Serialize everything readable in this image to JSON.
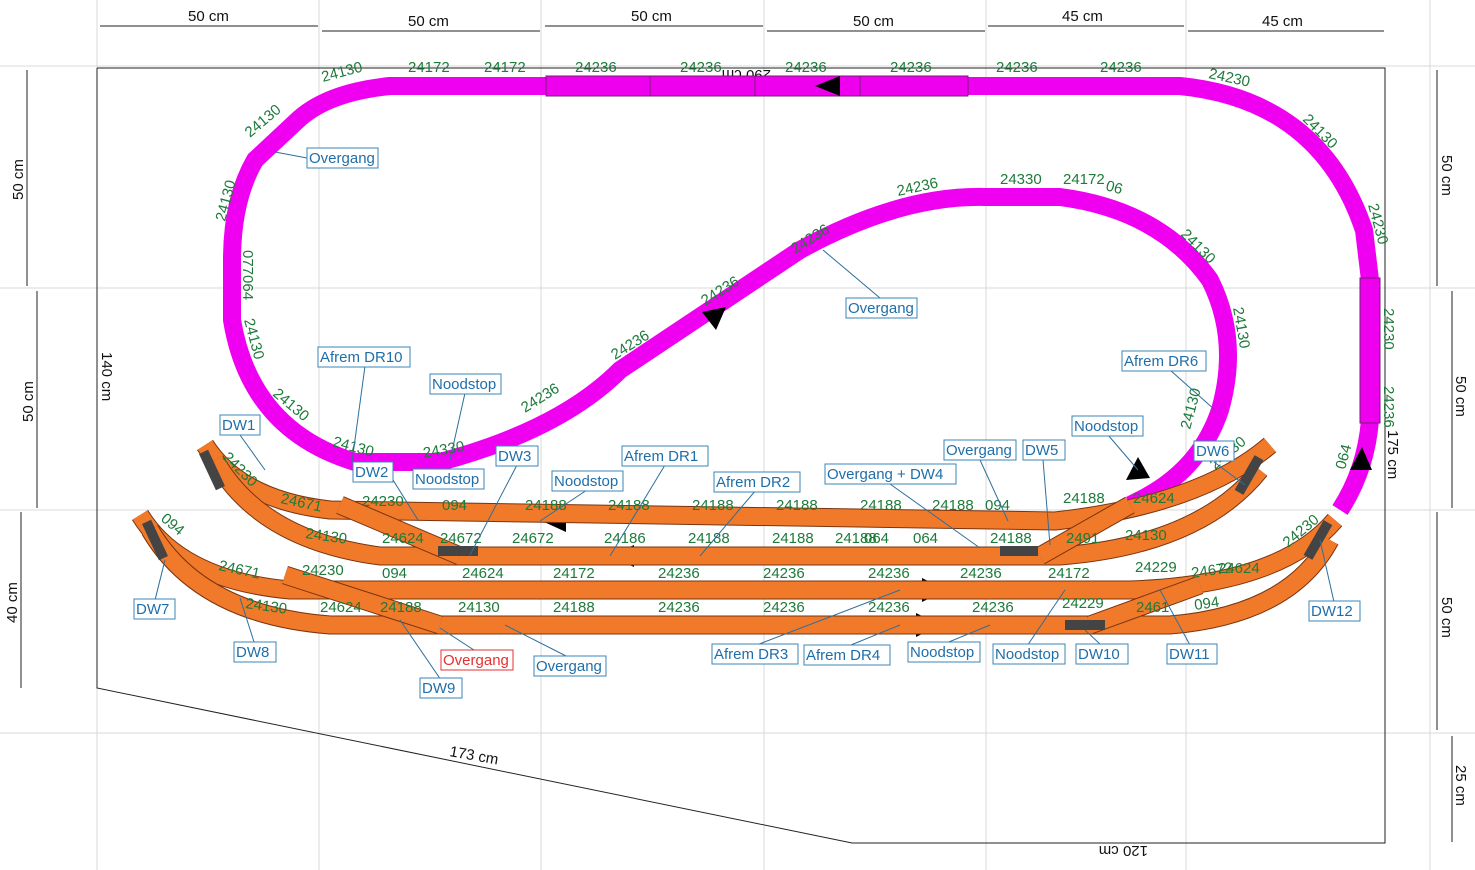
{
  "colors": {
    "upper_track": "#f000f0",
    "lower_track": "#f07a2a",
    "track_code": "#1d7a3a",
    "label_text": "#1f6ea9",
    "label_alert": "#e53030"
  },
  "dimensions": {
    "top": [
      "50 cm",
      "50 cm",
      "50 cm",
      "50 cm",
      "45 cm",
      "45 cm"
    ],
    "left": [
      "50 cm",
      "50 cm",
      "40 cm"
    ],
    "right": [
      "50 cm",
      "50 cm",
      "50 cm",
      "25 cm"
    ],
    "board_left": "140 cm",
    "board_right": "175 cm",
    "board_top_inner": "290 cm",
    "board_diagonal": "173 cm",
    "board_bottom": "120 cm"
  },
  "track_codes": [
    "24130",
    "24172",
    "24172",
    "24236",
    "24236",
    "24236",
    "24236",
    "24236",
    "24236",
    "24230",
    "24130",
    "24130",
    "077064",
    "24130",
    "24130",
    "24130",
    "24330",
    "24236",
    "24236",
    "24236",
    "24236",
    "24236",
    "24330",
    "24172",
    "06",
    "24130",
    "24130",
    "24130",
    "24130",
    "24230",
    "24230",
    "24236",
    "064",
    "24230",
    "24671",
    "24130",
    "24230",
    "24624",
    "094",
    "24188",
    "24188",
    "24188",
    "24188",
    "24188",
    "24188",
    "094",
    "24188",
    "24624",
    "24130",
    "24230",
    "24672",
    "24672",
    "24186",
    "24188",
    "24188",
    "24188",
    "064",
    "064",
    "24188",
    "2491",
    "094",
    "24671",
    "24130",
    "24230",
    "24624",
    "094",
    "24188",
    "24624",
    "24172",
    "24236",
    "24236",
    "24236",
    "24236",
    "24172",
    "24229",
    "24624",
    "24130",
    "24188",
    "24236",
    "24236",
    "24236",
    "24236",
    "24229",
    "2461",
    "094",
    "24230",
    "24672",
    "24130"
  ],
  "labels": {
    "overgang_1": "Overgang",
    "overgang_2": "Overgang",
    "afrem_dr10": "Afrem DR10",
    "noodstop_1": "Noodstop",
    "afrem_dr6": "Afrem DR6",
    "noodstop_2": "Noodstop",
    "dw1": "DW1",
    "dw2": "DW2",
    "noodstop_3": "Noodstop",
    "dw3": "DW3",
    "noodstop_4": "Noodstop",
    "afrem_dr1": "Afrem DR1",
    "afrem_dr2": "Afrem DR2",
    "overgang_3": "Overgang",
    "dw5": "DW5",
    "overgang_dw4": "Overgang + DW4",
    "dw6": "DW6",
    "dw7": "DW7",
    "dw8": "DW8",
    "overgang_red": "Overgang",
    "overgang_4": "Overgang",
    "dw9": "DW9",
    "afrem_dr3": "Afrem DR3",
    "afrem_dr4": "Afrem DR4",
    "noodstop_5": "Noodstop",
    "noodstop_6": "Noodstop",
    "dw10": "DW10",
    "dw11": "DW11",
    "dw12": "DW12"
  }
}
